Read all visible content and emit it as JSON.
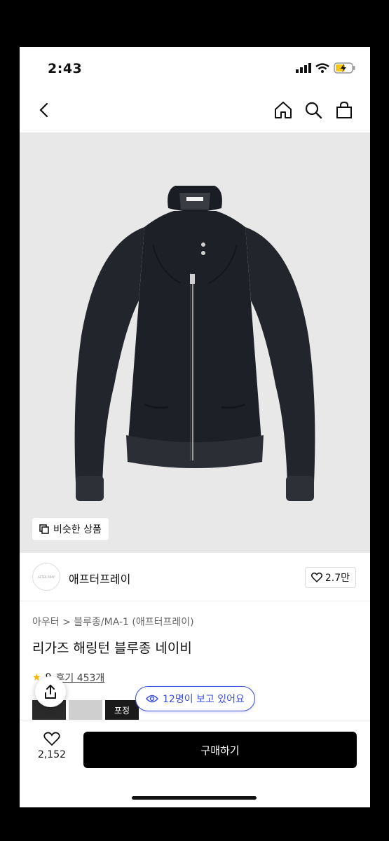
{
  "status": {
    "time": "2:43"
  },
  "hero": {
    "similar_label": "비슷한 상품",
    "brand_tag": "AFTER PRAY"
  },
  "brand": {
    "logo_text": "AFTER PRAY",
    "name": "애프터프레이",
    "likes": "2.7만"
  },
  "product": {
    "breadcrumb": "아우터 > 블루종/MA-1 (애프터프레이)",
    "title": "리가즈 해링턴 블루종 네이비",
    "rating": "9",
    "reviews": "후기 453개"
  },
  "viewers": {
    "label": "12명이 보고 있어요"
  },
  "thumbs": [
    {
      "label": ""
    },
    {
      "label": ""
    },
    {
      "label": "포정"
    }
  ],
  "bottom": {
    "wish_count": "2,152",
    "buy_label": "구매하기"
  },
  "colors": {
    "accent": "#3c4fd8",
    "buy_button": "#000000",
    "hero_bg": "#e8e8e8",
    "star": "#f5b70a"
  }
}
